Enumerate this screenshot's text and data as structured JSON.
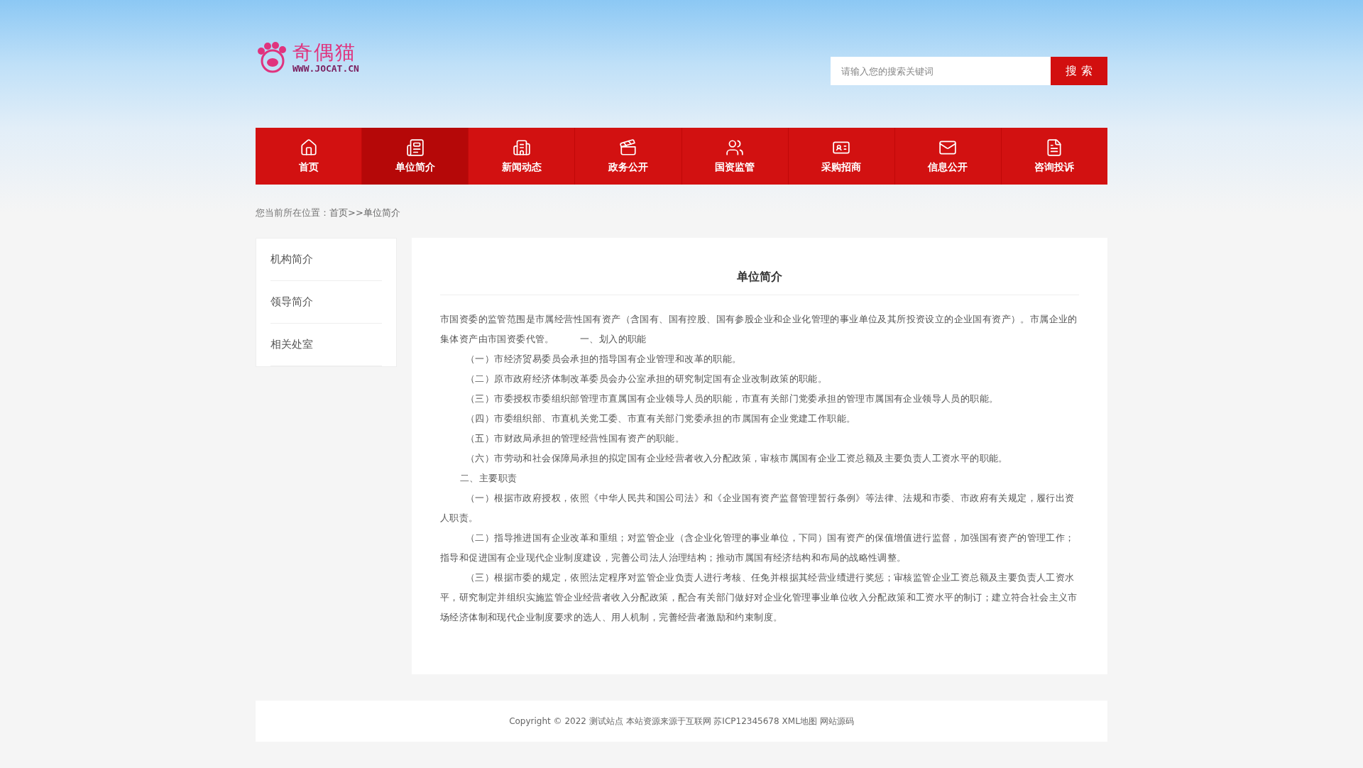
{
  "logo": {
    "name": "奇偶猫",
    "url": "WWW.JOCAT.CN"
  },
  "search": {
    "placeholder": "请输入您的搜索关键词",
    "button": "搜 索"
  },
  "nav": [
    {
      "label": "首页",
      "selected": false
    },
    {
      "label": "单位简介",
      "selected": true
    },
    {
      "label": "新闻动态",
      "selected": false
    },
    {
      "label": "政务公开",
      "selected": false
    },
    {
      "label": "国资监管",
      "selected": false
    },
    {
      "label": "采购招商",
      "selected": false
    },
    {
      "label": "信息公开",
      "selected": false
    },
    {
      "label": "咨询投诉",
      "selected": false
    }
  ],
  "breadcrumb": {
    "prefix": "您当前所在位置：",
    "links": [
      "首页",
      ">>单位简介"
    ]
  },
  "sidebar": {
    "items": [
      "机构简介",
      "领导简介",
      "相关处室"
    ]
  },
  "article": {
    "title": "单位简介",
    "paragraphs": [
      {
        "kind": "plain",
        "text": "市国资委的监管范围是市属经营性国有资产（含国有、国有控股、国有参股企业和企业化管理的事业单位及其所投资设立的企业国有资产）。市属企业的集体资产由市国资委代管。        一、划入的职能"
      },
      {
        "kind": "item",
        "text": "（一）市经济贸易委员会承担的指导国有企业管理和改革的职能。"
      },
      {
        "kind": "item",
        "text": "（二）原市政府经济体制改革委员会办公室承担的研究制定国有企业改制政策的职能。"
      },
      {
        "kind": "item",
        "text": "（三）市委授权市委组织部管理市直属国有企业领导人员的职能，市直有关部门党委承担的管理市属国有企业领导人员的职能。"
      },
      {
        "kind": "item",
        "text": "（四）市委组织部、市直机关党工委、市直有关部门党委承担的市属国有企业党建工作职能。"
      },
      {
        "kind": "item",
        "text": "（五）市财政局承担的管理经营性国有资产的职能。"
      },
      {
        "kind": "item",
        "text": "（六）市劳动和社会保障局承担的拟定国有企业经营者收入分配政策，审核市属国有企业工资总额及主要负责人工资水平的职能。"
      },
      {
        "kind": "section",
        "text": "二、主要职责"
      },
      {
        "kind": "item",
        "text": "（一）根据市政府授权，依照《中华人民共和国公司法》和《企业国有资产监督管理暂行条例》等法律、法规和市委、市政府有关规定，履行出资人职责。"
      },
      {
        "kind": "item",
        "text": "（二）指导推进国有企业改革和重组；对监管企业（含企业化管理的事业单位，下同）国有资产的保值增值进行监督，加强国有资产的管理工作；指导和促进国有企业现代企业制度建设，完善公司法人治理结构；推动市属国有经济结构和布局的战略性调整。"
      },
      {
        "kind": "item",
        "text": "（三）根据市委的规定，依照法定程序对监管企业负责人进行考核、任免并根据其经营业绩进行奖惩；审核监管企业工资总额及主要负责人工资水平，研究制定并组织实施监管企业经营者收入分配政策，配合有关部门做好对企业化管理事业单位收入分配政策和工资水平的制订；建立符合社会主义市场经济体制和现代企业制度要求的选人、用人机制，完善经营者激励和约束制度。"
      }
    ]
  },
  "footer": {
    "text": "Copyright © 2022 测试站点 本站资源来源于互联网 苏ICP12345678",
    "links": [
      "XML地图",
      "网站源码"
    ]
  }
}
